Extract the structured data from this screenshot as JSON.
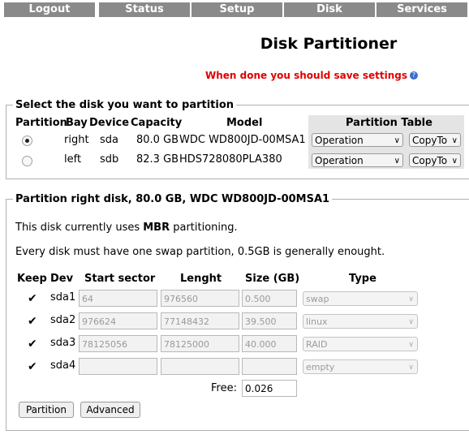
{
  "nav": {
    "logout": "Logout",
    "status": "Status",
    "setup": "Setup",
    "disk": "Disk",
    "services": "Services"
  },
  "title": "Disk Partitioner",
  "save_note": "When done you should save settings",
  "select_disk": {
    "legend": "Select the disk you want to partition",
    "headers": {
      "partition": "Partition",
      "bay": "Bay",
      "device": "Device",
      "capacity": "Capacity",
      "model": "Model",
      "partition_table": "Partition Table"
    },
    "rows": [
      {
        "selected": true,
        "bay": "right",
        "device": "sda",
        "capacity": "80.0 GB",
        "model": "WDC WD800JD-00MSA1",
        "operation": "Operation",
        "copyto": "CopyTo"
      },
      {
        "selected": false,
        "bay": "left",
        "device": "sdb",
        "capacity": "82.3 GB",
        "model": "HDS728080PLA380",
        "operation": "Operation",
        "copyto": "CopyTo"
      }
    ]
  },
  "partition": {
    "legend": "Partition right disk, 80.0 GB, WDC WD800JD-00MSA1",
    "info_prefix": "This disk currently uses ",
    "info_scheme": "MBR",
    "info_suffix": " partitioning.",
    "swap_note": "Every disk must have one swap partition, 0.5GB is generally enought.",
    "headers": {
      "keep": "Keep",
      "dev": "Dev",
      "start": "Start sector",
      "length": "Lenght",
      "size": "Size (GB)",
      "type": "Type"
    },
    "rows": [
      {
        "keep": true,
        "dev": "sda1",
        "start": "64",
        "length": "976560",
        "size": "0.500",
        "type": "swap"
      },
      {
        "keep": true,
        "dev": "sda2",
        "start": "976624",
        "length": "77148432",
        "size": "39.500",
        "type": "linux"
      },
      {
        "keep": true,
        "dev": "sda3",
        "start": "78125056",
        "length": "78125000",
        "size": "40.000",
        "type": "RAID"
      },
      {
        "keep": true,
        "dev": "sda4",
        "start": "",
        "length": "",
        "size": "",
        "type": "empty"
      }
    ],
    "free_label": "Free:",
    "free_value": "0.026",
    "partition_button": "Partition",
    "advanced_button": "Advanced"
  }
}
